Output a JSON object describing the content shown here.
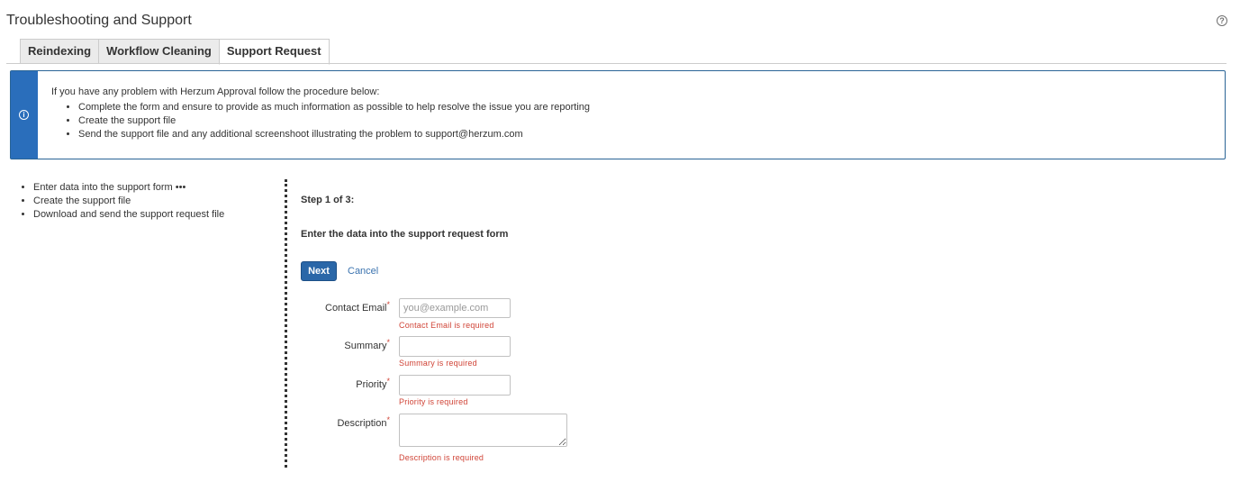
{
  "page": {
    "title": "Troubleshooting and Support",
    "help_icon": "question-circle"
  },
  "tabs": [
    {
      "label": "Reindexing",
      "active": false
    },
    {
      "label": "Workflow Cleaning",
      "active": false
    },
    {
      "label": "Support Request",
      "active": true
    }
  ],
  "info": {
    "icon": "info-circle",
    "intro": "If you have any problem with Herzum Approval follow the procedure below:",
    "items": [
      "Complete the form and ensure to provide as much information as possible to help resolve the issue you are reporting",
      "Create the support file",
      "Send the support file and any additional screenshoot illustrating the problem to support@herzum.com"
    ]
  },
  "steps": {
    "items": [
      "Enter data into the support form •••",
      "Create the support file",
      "Download and send the support request file"
    ]
  },
  "form": {
    "step_heading": "Step 1 of 3:",
    "step_description": "Enter the data into the support request form",
    "next_label": "Next",
    "cancel_label": "Cancel",
    "required_marker": "*",
    "fields": {
      "email": {
        "label": "Contact Email",
        "value": "",
        "placeholder": "you@example.com",
        "error": "Contact Email is required"
      },
      "summary": {
        "label": "Summary",
        "value": "",
        "placeholder": "",
        "error": "Summary is required"
      },
      "priority": {
        "label": "Priority",
        "value": "",
        "placeholder": "",
        "error": "Priority is required"
      },
      "description": {
        "label": "Description",
        "value": "",
        "placeholder": "",
        "error": "Description is required"
      }
    }
  },
  "colors": {
    "accent": "#2a6ebb",
    "button": "#2a67a8",
    "link": "#3b73af",
    "error": "#d04437"
  }
}
